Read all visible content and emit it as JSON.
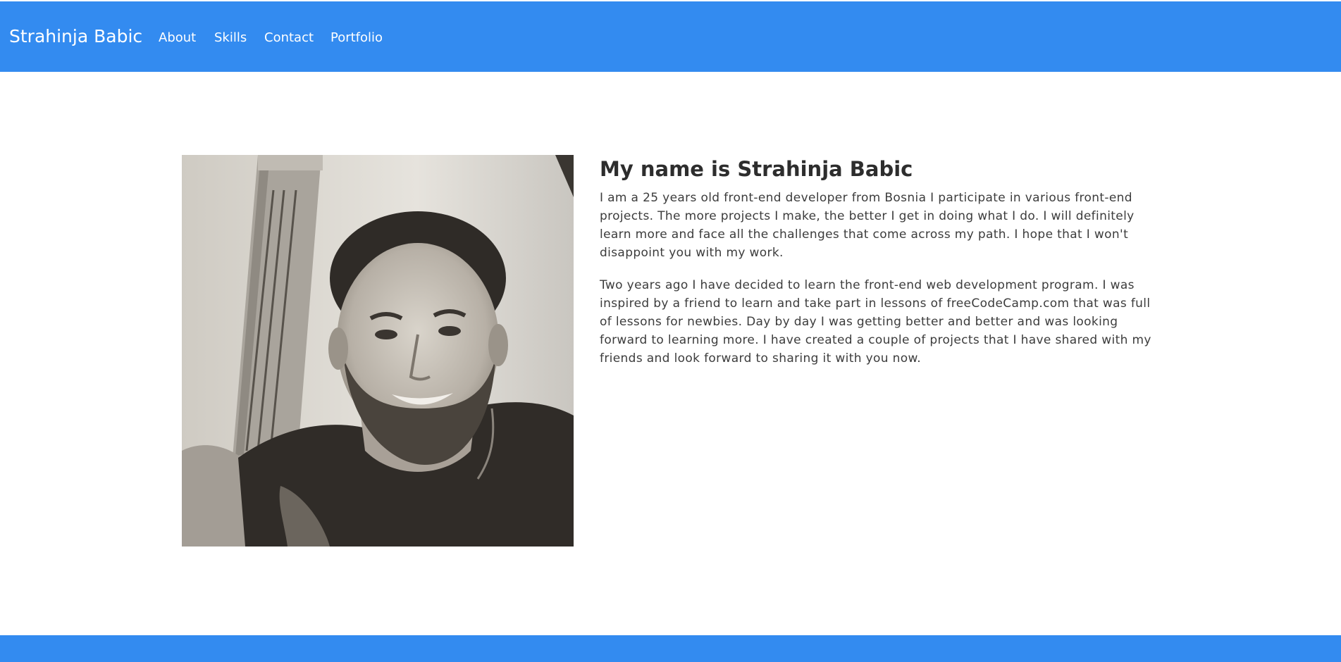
{
  "header": {
    "brand": "Strahinja Babic",
    "nav": [
      {
        "label": "About"
      },
      {
        "label": "Skills"
      },
      {
        "label": "Contact"
      },
      {
        "label": "Portfolio"
      }
    ]
  },
  "profile": {
    "heading": "My name is Strahinja Babic",
    "paragraphs": [
      "I am a 25 years old front-end developer from Bosnia I participate in various front-end projects. The more projects I make, the better I get in doing what I do. I will definitely learn more and face all the challenges that come across my path. I hope that I won't disappoint you with my work.",
      "Two years ago I have decided to learn the front-end web development program. I was inspired by a friend to learn and take part in lessons of freeCodeCamp.com that was full of lessons for newbies. Day by day I was getting better and better and was looking forward to learning more. I have created a couple of projects that I have shared with my friends and look forward to sharing it with you now."
    ]
  },
  "colors": {
    "accent": "#338bf0",
    "text": "#3c3c3c",
    "background": "#ffffff"
  }
}
